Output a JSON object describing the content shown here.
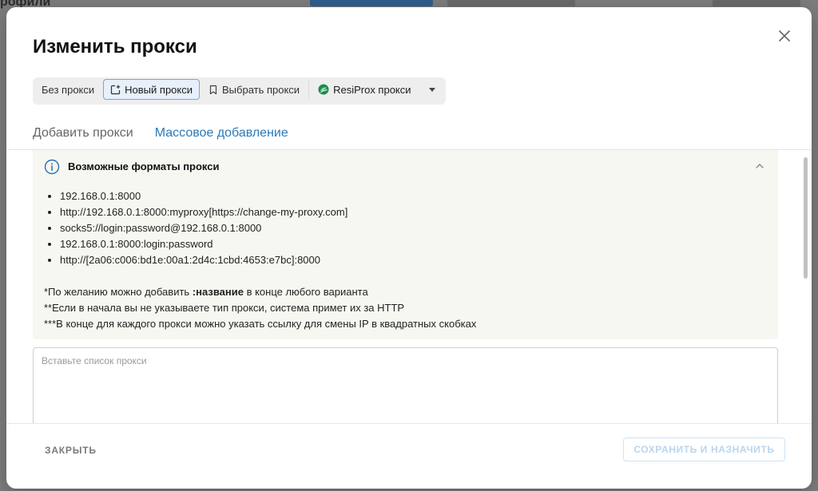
{
  "background": {
    "title_fragment": "рофили"
  },
  "modal": {
    "title": "Изменить прокси",
    "close_icon": "close-icon",
    "modes": [
      {
        "label": "Без прокси",
        "icon": ""
      },
      {
        "label": "Новый прокси",
        "icon": "add-box-icon",
        "active": true
      },
      {
        "label": "Выбрать прокси",
        "icon": "bookmark-icon"
      },
      {
        "label": "ResiProx прокси",
        "icon": "resiprox-logo-icon"
      }
    ],
    "tabs": [
      {
        "label": "Добавить прокси",
        "active": false
      },
      {
        "label": "Массовое добавление",
        "active": true
      }
    ],
    "info": {
      "title": "Возможные форматы прокси",
      "formats": [
        "192.168.0.1:8000",
        "http://192.168.0.1:8000:myproxy[https://change-my-proxy.com]",
        "socks5://login:password@192.168.0.1:8000",
        "192.168.0.1:8000:login:password",
        "http://[2a06:c006:bd1e:00a1:2d4c:1cbd:4653:e7bc]:8000"
      ],
      "note1_prefix": "*По желанию можно добавить ",
      "note1_bold": ":название",
      "note1_suffix": " в конце любого варианта",
      "note2": "**Если в начала вы не указываете тип прокси, система примет их за HTTP",
      "note3": "***В конце для каждого прокси можно указать ссылку для смены IP в квадратных скобках"
    },
    "input": {
      "placeholder": "Вставьте список прокси",
      "value": ""
    },
    "footer": {
      "close_label": "ЗАКРЫТЬ",
      "save_label": "СОХРАНИТЬ И НАЗНАЧИТЬ"
    }
  },
  "colors": {
    "accent": "#2a7ab8",
    "info_bg": "#f7f7f2",
    "active_mode_bg": "#e7f0fb",
    "active_mode_border": "#7aa6d6",
    "disabled_text": "#b8d6ee",
    "resiprox_green": "#1e8a4f"
  }
}
